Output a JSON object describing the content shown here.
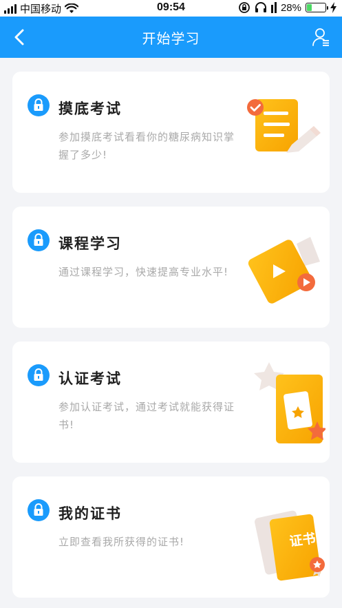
{
  "status_bar": {
    "carrier": "中国移动",
    "time": "09:54",
    "battery_percent": "28%",
    "battery_level": 0.28
  },
  "header": {
    "title": "开始学习",
    "back_icon": "chevron-left-icon",
    "user_icon": "user-list-icon"
  },
  "colors": {
    "header_bg": "#1a9bfc",
    "accent_orange": "#fcb619",
    "lock_blue": "#1a9bfc",
    "desc_gray": "#a9a9a9"
  },
  "cards": [
    {
      "title": "摸底考试",
      "desc": "参加摸底考试看看你的糖尿病知识掌握了多少!",
      "icon": "exam-paper-icon",
      "locked": true
    },
    {
      "title": "课程学习",
      "desc": "通过课程学习，快速提高专业水平!",
      "icon": "video-play-icon",
      "locked": true
    },
    {
      "title": "认证考试",
      "desc": "参加认证考试，通过考试就能获得证书!",
      "icon": "star-card-icon",
      "locked": true
    },
    {
      "title": "我的证书",
      "desc": "立即查看我所获得的证书!",
      "icon": "certificate-icon",
      "locked": true,
      "illustration_text": "证书"
    }
  ]
}
